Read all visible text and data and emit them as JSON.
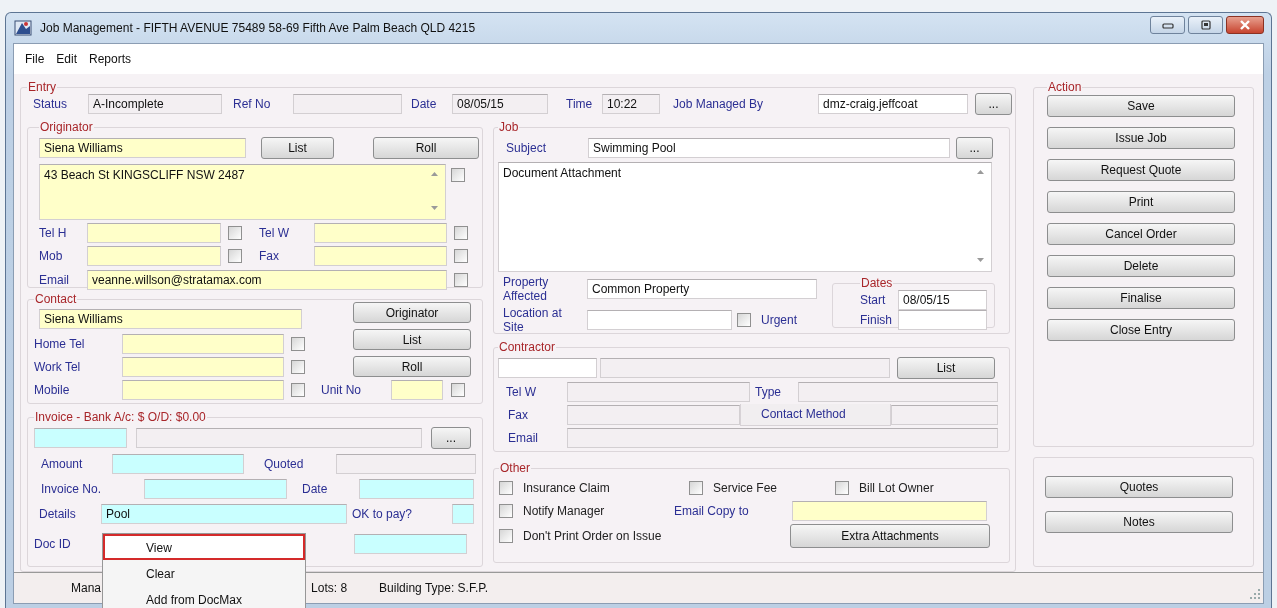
{
  "window": {
    "title": "Job Management - FIFTH AVENUE 75489 58-69 Fifth Ave Palm Beach QLD 4215"
  },
  "menu": [
    {
      "label": "File"
    },
    {
      "label": "Edit"
    },
    {
      "label": "Reports"
    }
  ],
  "entry": {
    "legend": "Entry",
    "status": {
      "label": "Status",
      "value": "A-Incomplete"
    },
    "ref_no": {
      "label": "Ref No"
    },
    "date": {
      "label": "Date",
      "value": "08/05/15"
    },
    "time": {
      "label": "Time",
      "value": "10:22"
    },
    "job_managed_by": {
      "label": "Job Managed By",
      "value": "dmz-craig.jeffcoat",
      "button": "..."
    }
  },
  "originator": {
    "legend": "Originator",
    "name": "Siena Williams",
    "list_button": "List",
    "roll_button": "Roll",
    "address": "43 Beach St KINGSCLIFF  NSW  2487",
    "address_checked": false,
    "phones": [
      {
        "label": "Tel H",
        "checked": false
      },
      {
        "label": "Tel W",
        "checked": false
      },
      {
        "label": "Mob",
        "checked": false
      },
      {
        "label": "Fax",
        "checked": false
      }
    ],
    "email": {
      "label": "Email",
      "value": "veanne.willson@stratamax.com",
      "checked": false
    }
  },
  "contact": {
    "legend": "Contact",
    "name": "Siena Williams",
    "phones": [
      {
        "label": "Home Tel",
        "checked": false
      },
      {
        "label": "Work Tel",
        "checked": false
      },
      {
        "label": "Mobile",
        "checked": false
      }
    ],
    "buttons": [
      "Originator",
      "List",
      "Roll"
    ],
    "unit_no": {
      "label": "Unit No",
      "checked": false
    }
  },
  "invoice": {
    "legend": "Invoice - Bank A/c: $ O/D: $0.00",
    "browse_button": "...",
    "amount": {
      "label": "Amount"
    },
    "quoted": {
      "label": "Quoted"
    },
    "invoice_no": {
      "label": "Invoice No."
    },
    "date": {
      "label": "Date"
    },
    "details": {
      "label": "Details",
      "value": "Pool"
    },
    "ok_to_pay": {
      "label": "OK to pay?"
    },
    "doc_id": {
      "label": "Doc ID"
    }
  },
  "job": {
    "legend": "Job",
    "subject": {
      "label": "Subject",
      "value": "Swimming Pool",
      "button": "..."
    },
    "description": "Document Attachment",
    "property_affected": {
      "label": "Property Affected",
      "value": "Common Property"
    },
    "location": {
      "label": "Location at Site"
    },
    "urgent": {
      "label": "Urgent",
      "checked": false
    },
    "dates": {
      "legend": "Dates",
      "start": {
        "label": "Start",
        "value": "08/05/15"
      },
      "finish": {
        "label": "Finish"
      }
    }
  },
  "contractor": {
    "legend": "Contractor",
    "list_button": "List",
    "tel_w": {
      "label": "Tel W"
    },
    "type": {
      "label": "Type"
    },
    "fax": {
      "label": "Fax"
    },
    "contact_method": {
      "label": "Contact Method"
    },
    "email": {
      "label": "Email"
    }
  },
  "other": {
    "legend": "Other",
    "options": [
      {
        "label": "Insurance Claim",
        "checked": false
      },
      {
        "label": "Service Fee",
        "checked": false
      },
      {
        "label": "Bill Lot Owner",
        "checked": false
      },
      {
        "label": "Notify Manager",
        "checked": false
      },
      {
        "label": "Don't Print Order on Issue",
        "checked": false
      }
    ],
    "email_copy_to": {
      "label": "Email Copy to"
    },
    "extra_button": "Extra Attachments"
  },
  "action": {
    "legend": "Action",
    "buttons": [
      "Save",
      "Issue Job",
      "Request Quote",
      "Print",
      "Cancel Order",
      "Delete",
      "Finalise",
      "Close Entry"
    ]
  },
  "extra_buttons": [
    "Quotes",
    "Notes"
  ],
  "status_bar": [
    {
      "text": "Mana"
    },
    {
      "text": "Lots: 8"
    },
    {
      "text": "Building Type: S.F.P."
    }
  ],
  "context_menu": [
    {
      "label": "View",
      "selected": true
    },
    {
      "label": "Clear",
      "selected": false
    },
    {
      "label": "Add from DocMax",
      "selected": false
    }
  ]
}
